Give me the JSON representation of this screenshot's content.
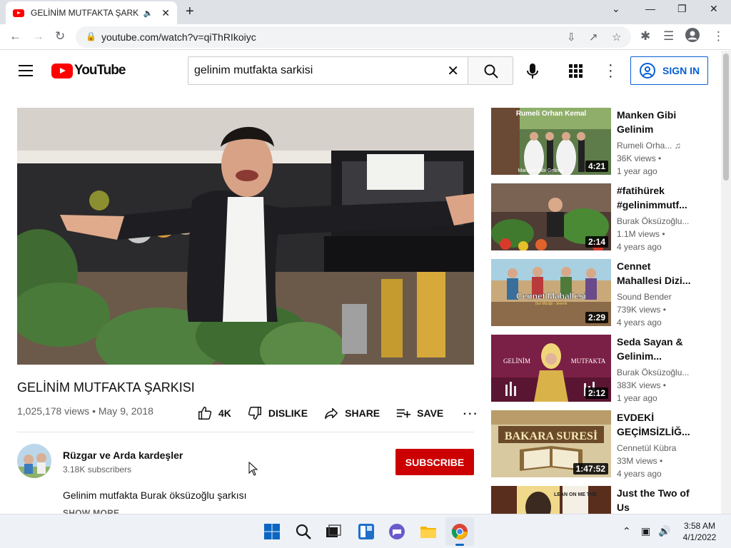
{
  "browser": {
    "tab_title": "GELİNİM MUTFAKTA ŞARKISI",
    "url": "youtube.com/watch?v=qiThRIkoiyc"
  },
  "header": {
    "logo_text": "YouTube",
    "search_query": "gelinim mutfakta sarkisi",
    "signin_label": "SIGN IN"
  },
  "video": {
    "title": "GELİNİM MUTFAKTA ŞARKISI",
    "meta": "1,025,178 views • May 9, 2018",
    "likes": "4K",
    "dislike_label": "DISLIKE",
    "share_label": "SHARE",
    "save_label": "SAVE"
  },
  "channel": {
    "name": "Rüzgar ve Arda kardeşler",
    "subscribers": "3.18K subscribers",
    "subscribe_label": "SUBSCRIBE",
    "description": "Gelinim mutfakta Burak öksüzoğlu şarkısı",
    "show_more": "SHOW MORE"
  },
  "suggestions": [
    {
      "title": "Manken Gibi Gelinim",
      "channel": "Rumeli Orha...",
      "views": "36K views •",
      "age": "1 year ago",
      "duration": "4:21",
      "thumb_caption_top": "Rumeli Orhan Kemal",
      "thumb_caption_bottom": "Manken Gibi Gelinim"
    },
    {
      "title": "#fatihürek #gelinimmutf...",
      "channel": "Burak Öksüzoğlu...",
      "views": "1.1M views •",
      "age": "4 years ago",
      "duration": "2:14"
    },
    {
      "title": "Cennet Mahallesi Dizi...",
      "channel": "Sound Bender",
      "views": "739K views •",
      "age": "4 years ago",
      "duration": "2:29",
      "thumb_caption_top": "Cennet Mahallesi",
      "thumb_caption_bottom": "Dizi Müziği - Jenerik"
    },
    {
      "title": "Seda Sayan & Gelinim...",
      "channel": "Burak Öksüzoğlu...",
      "views": "383K views •",
      "age": "1 year ago",
      "duration": "2:12",
      "thumb_caption_top": "GELİNİM",
      "thumb_caption_bottom": "MUTFAKTA"
    },
    {
      "title": "EVDEKİ GEÇİMSİZLİĞ...",
      "channel": "Cennetül Kübra",
      "views": "33M views •",
      "age": "4 years ago",
      "duration": "1:47:52",
      "thumb_caption_top": "BAKARA SURESİ"
    },
    {
      "title": "Just the Two of Us",
      "channel": "",
      "views": "",
      "age": "",
      "duration": "",
      "thumb_caption_top": "LEAN ON ME THE"
    }
  ],
  "taskbar": {
    "time": "3:58 AM",
    "date": "4/1/2022"
  },
  "colors": {
    "youtube_red": "#ff0000",
    "subscribe_red": "#cc0000",
    "signin_blue": "#065fd4"
  }
}
